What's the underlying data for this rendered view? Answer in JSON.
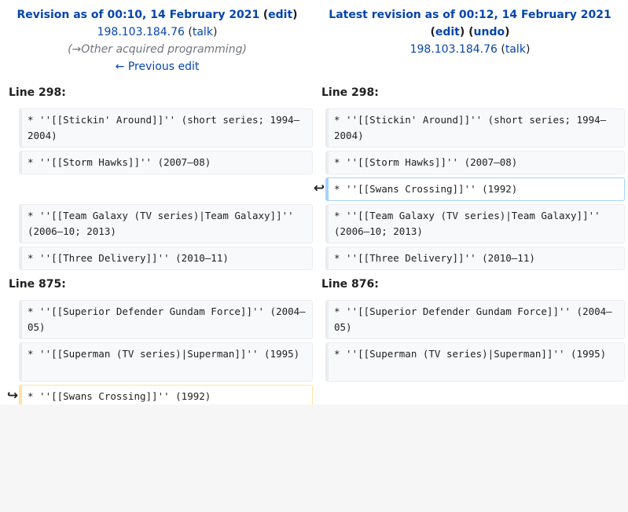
{
  "left_header": {
    "title": "Revision as of 00:10, 14 February 2021",
    "edit": "edit",
    "user": "198.103.184.76",
    "talk": "talk",
    "comment": "(→Other acquired programming)",
    "prev": "← Previous edit"
  },
  "right_header": {
    "title": "Latest revision as of 00:12, 14 February 2021",
    "edit": "edit",
    "undo": "undo",
    "user": "198.103.184.76",
    "talk": "talk"
  },
  "sections": [
    {
      "left_line": "Line 298:",
      "right_line": "Line 298:"
    },
    {
      "left_line": "Line 875:",
      "right_line": "Line 876:"
    }
  ],
  "rows": [
    {
      "left": "* ''[[Stickin' Around]]'' (short series; 1994–2004)",
      "right": "* ''[[Stickin' Around]]'' (short series; 1994–2004)"
    },
    {
      "left": "* ''[[Storm Hawks]]'' (2007–08)",
      "right": "* ''[[Storm Hawks]]'' (2007–08)"
    },
    {
      "left": "",
      "right": "* ''[[Swans Crossing]]'' (1992)",
      "marker": "↩"
    },
    {
      "left": "* ''[[Team Galaxy (TV series)|Team Galaxy]]'' (2006–10; 2013)",
      "right": "* ''[[Team Galaxy (TV series)|Team Galaxy]]'' (2006–10; 2013)"
    },
    {
      "left": "* ''[[Three Delivery]]'' (2010–11)",
      "right": "* ''[[Three Delivery]]'' (2010–11)"
    },
    {
      "left": "* ''[[Superior Defender Gundam Force]]'' (2004–05)",
      "right": "* ''[[Superior Defender Gundam Force]]'' (2004–05)"
    },
    {
      "left": "* ''[[Superman (TV series)|Superman]]'' (1995)",
      "right": "* ''[[Superman (TV series)|Superman]]'' (1995)"
    },
    {
      "left": "* ''[[Swans Crossing]]'' (1992)",
      "right": "",
      "marker": "↪"
    }
  ],
  "colors": {
    "link": "#0645ad",
    "added_border": "#a3d3ff",
    "deleted_border": "#ffe49c"
  }
}
